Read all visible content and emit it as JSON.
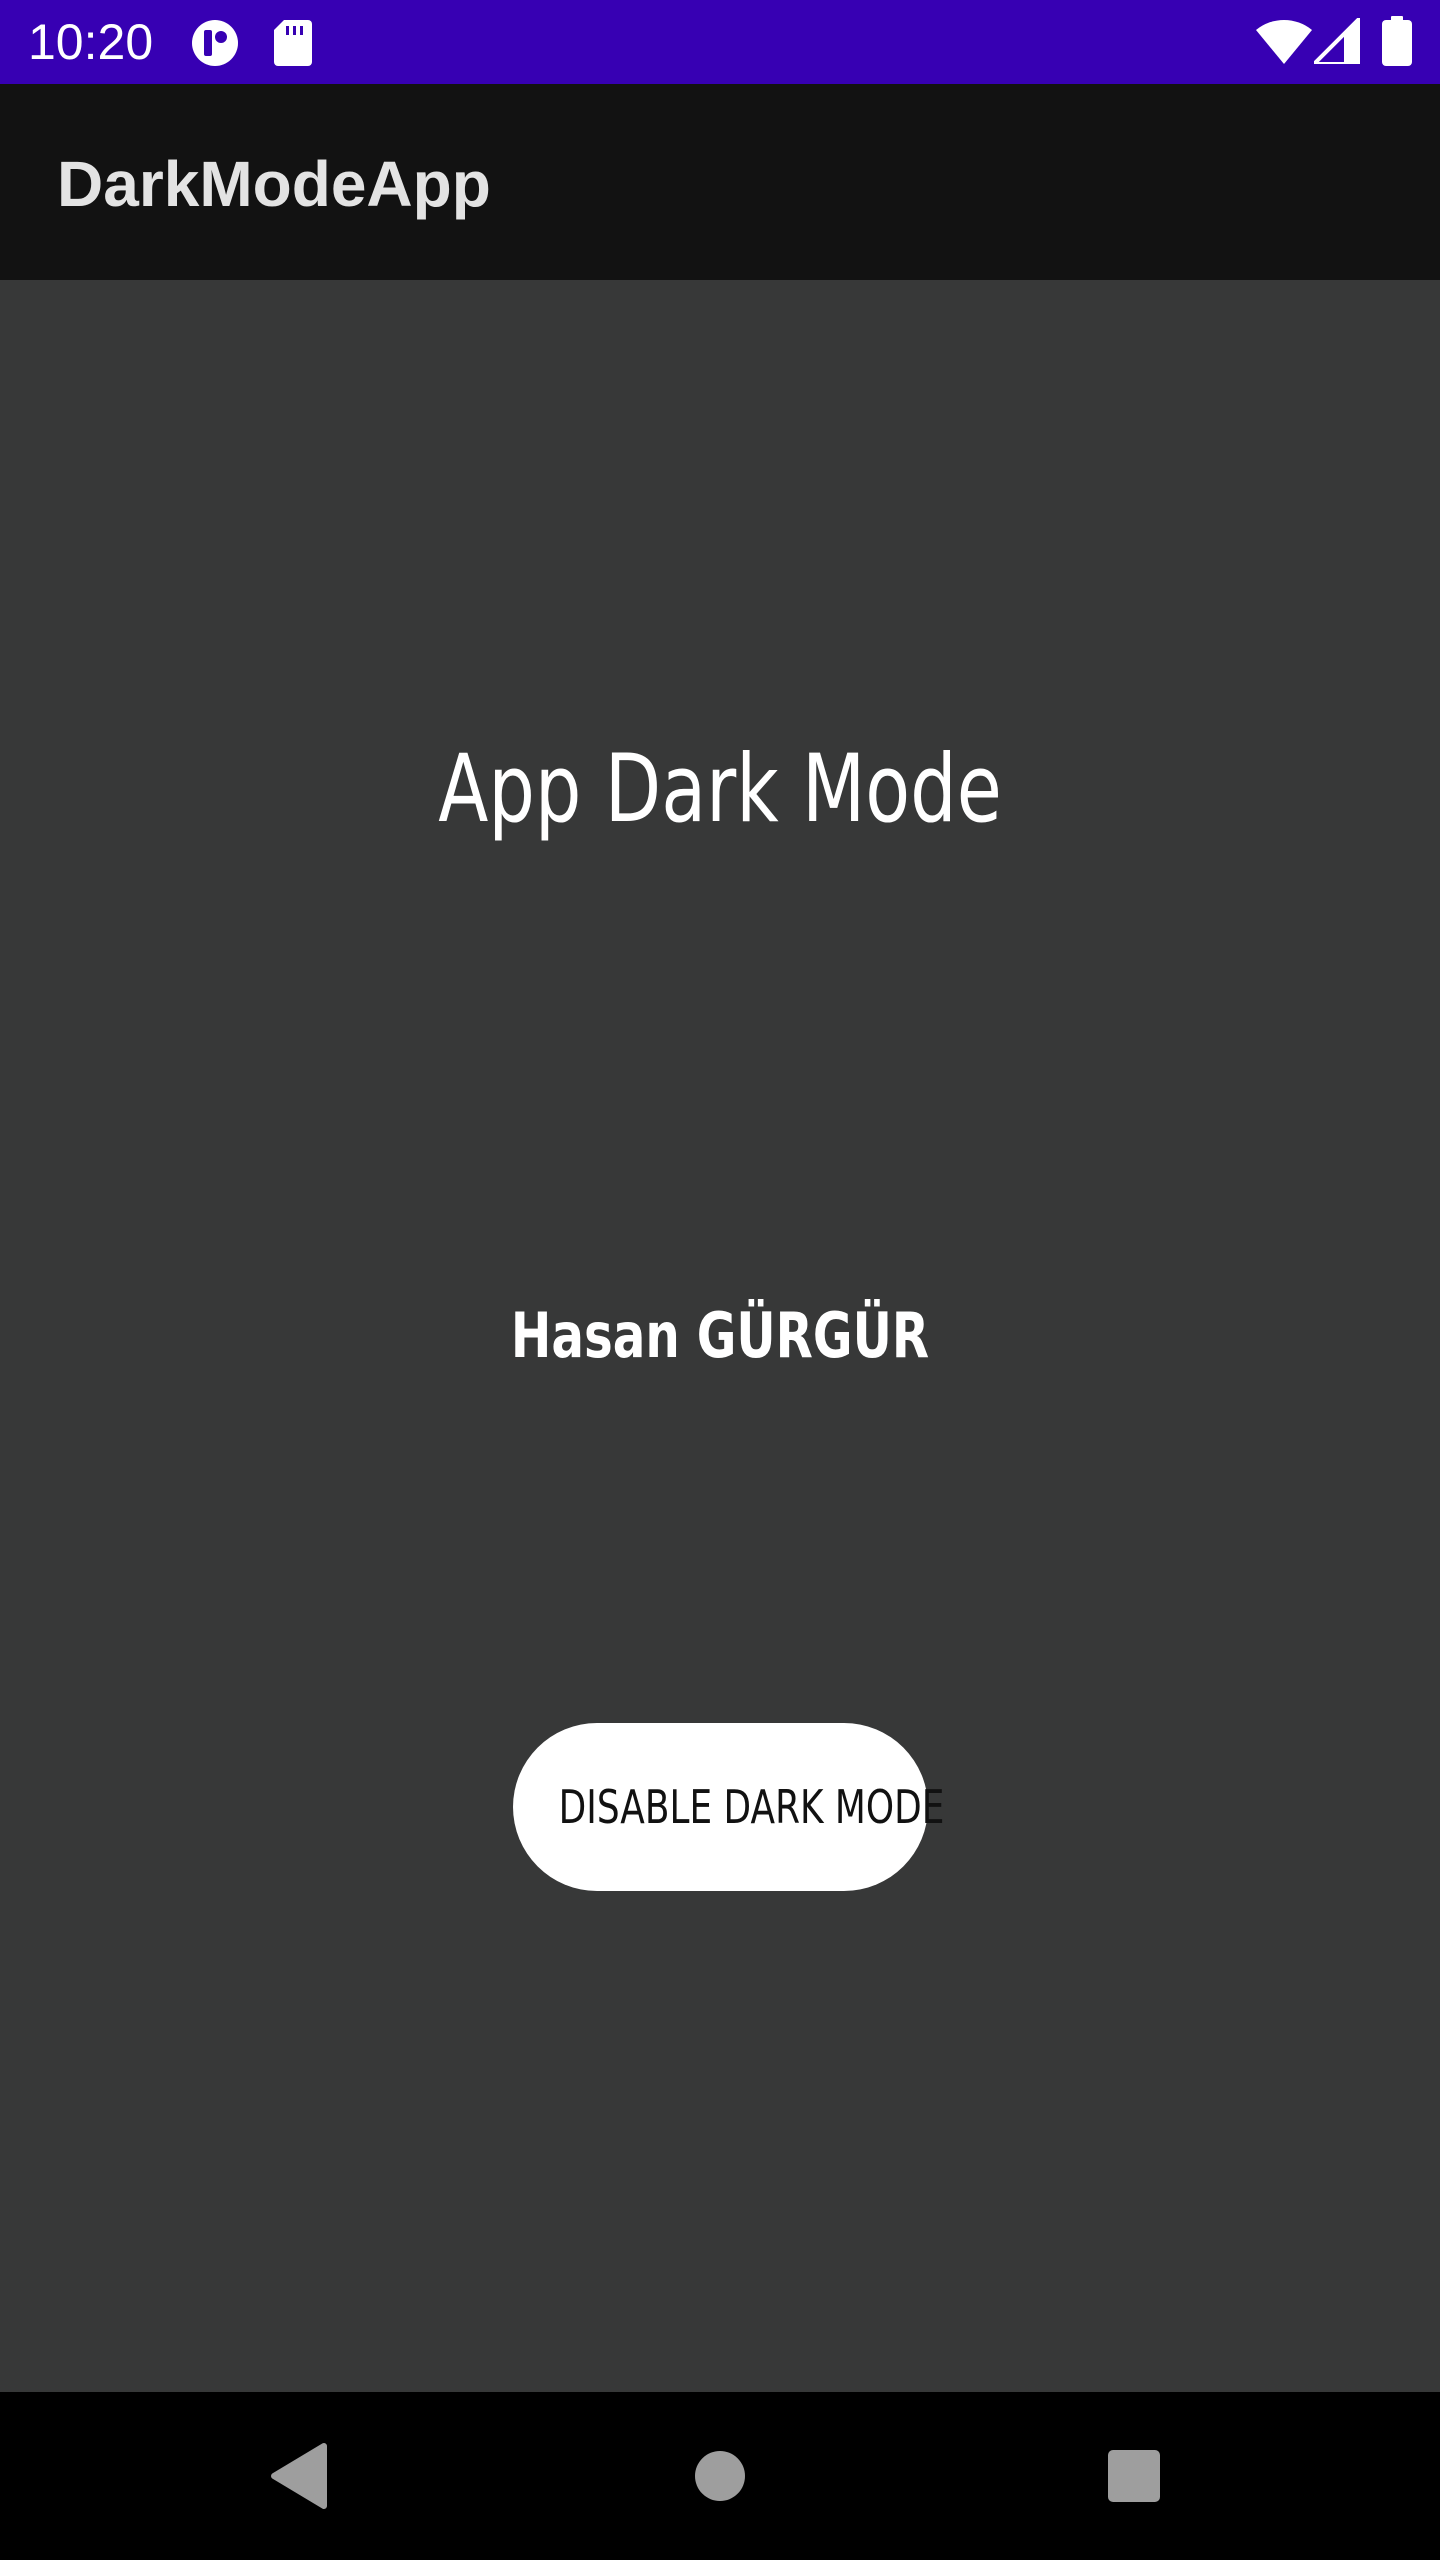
{
  "status_bar": {
    "time": "10:20",
    "background": "#3700b3",
    "left_icons": [
      "app-notification-icon",
      "sd-card-icon"
    ],
    "right_icons": [
      "wifi-icon",
      "cellular-signal-icon",
      "battery-icon"
    ]
  },
  "app_bar": {
    "title": "DarkModeApp",
    "background": "#121212",
    "title_color": "#e3e3e3"
  },
  "content": {
    "background": "#373838",
    "heading": "App Dark Mode",
    "author": "Hasan GÜRGÜR",
    "toggle_button_label": "DISABLE DARK MODE",
    "button_background": "#ffffff"
  },
  "nav_bar": {
    "background": "#000000",
    "buttons": [
      "back-icon",
      "home-icon",
      "recents-icon"
    ]
  }
}
